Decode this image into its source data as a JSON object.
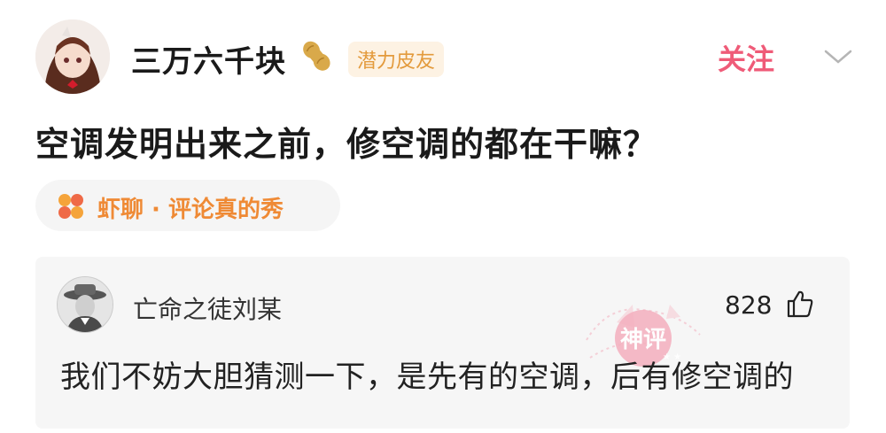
{
  "post": {
    "author": "三万六千块",
    "author_badge": "潜力皮友",
    "follow_label": "关注",
    "title": "空调发明出来之前，修空调的都在干嘛？"
  },
  "channel": {
    "label": "虾聊 · 评论真的秀"
  },
  "comment": {
    "author": "亡命之徒刘某",
    "likes": "828",
    "text": "我们不妨大胆猜测一下，是先有的空调，后有修空调的",
    "stamp_text": "神评"
  },
  "colors": {
    "follow": "#ef5b78",
    "badge_bg": "#fdf2e3",
    "badge_text": "#e39a3c",
    "channel_text": "#ef8a35",
    "stamp": "#f3a7b7"
  },
  "icons": [
    "peanut-icon",
    "chevron-down-icon",
    "app-grid-icon",
    "thumbs-up-icon",
    "divine-comment-stamp"
  ]
}
